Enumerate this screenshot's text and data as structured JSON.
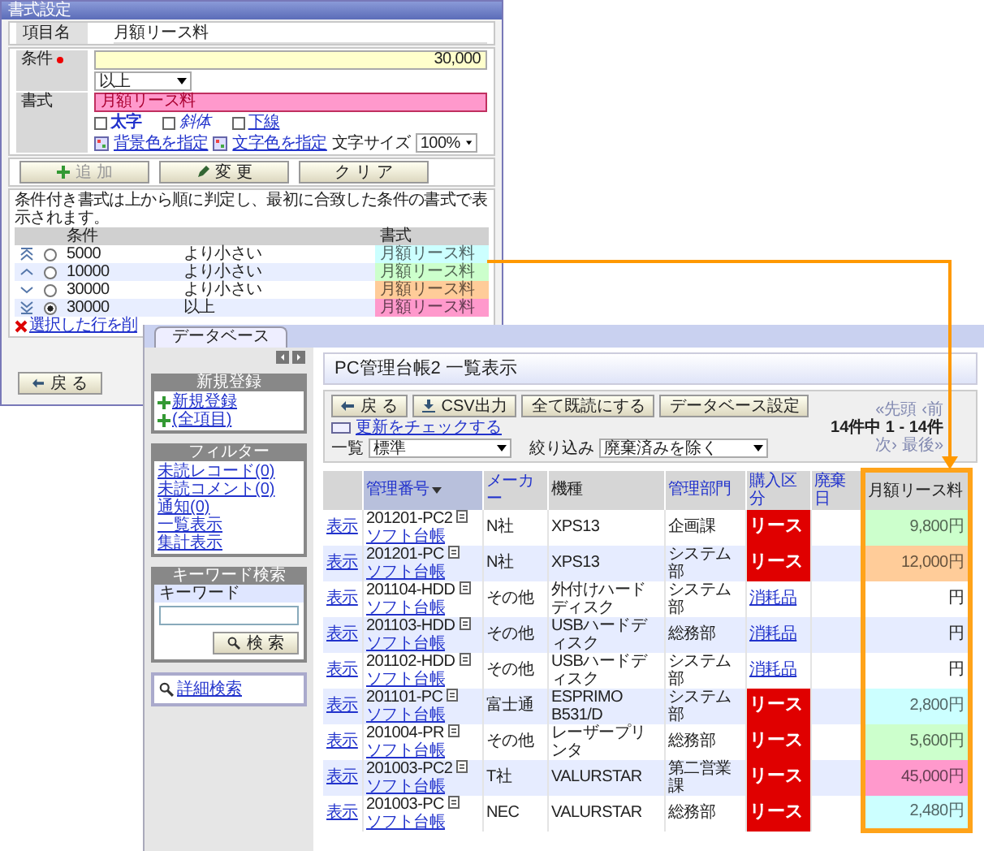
{
  "format_dialog": {
    "title": "書式設定",
    "item_name": {
      "label": "項目名",
      "value": "月額リース料"
    },
    "condition": {
      "label": "条件",
      "required": true,
      "value": "30,000",
      "operator": "以上"
    },
    "format": {
      "label": "書式",
      "preview": "月額リース料",
      "styles": [
        {
          "label": "太字",
          "kind": "bold",
          "checked": false
        },
        {
          "label": "斜体",
          "kind": "italic",
          "checked": false
        },
        {
          "label": "下線",
          "kind": "underline",
          "checked": false
        }
      ],
      "bg_color_link": "背景色を指定",
      "text_color_link": "文字色を指定",
      "size_label": "文字サイズ",
      "size": "100%"
    },
    "buttons": [
      {
        "label": "追 加",
        "disabled": true
      },
      {
        "label": "変 更",
        "disabled": false
      },
      {
        "label": "ク リ ア",
        "disabled": false
      }
    ],
    "note": "条件付き書式は上から順に判定し、最初に合致した条件の書式で表示されます。",
    "rules_table": {
      "columns": [
        "条件",
        "書式"
      ],
      "rows": [
        {
          "value": "5000",
          "operator": "より小さい",
          "preview": "月額リース料",
          "color": "#ccffff",
          "selected": false
        },
        {
          "value": "10000",
          "operator": "より小さい",
          "preview": "月額リース料",
          "color": "#ccffcc",
          "selected": false
        },
        {
          "value": "30000",
          "operator": "より小さい",
          "preview": "月額リース料",
          "color": "#ffcc99",
          "selected": false
        },
        {
          "value": "30000",
          "operator": "以上",
          "preview": "月額リース料",
          "color": "#ff99cc",
          "selected": true
        }
      ]
    },
    "delete_link": "選択した行を削",
    "back_button": "戻 る"
  },
  "database_window": {
    "tab": "データベース",
    "sidebar": {
      "sections": [
        {
          "title": "新規登録",
          "links": [
            "新規登録",
            "(全項目)"
          ]
        },
        {
          "title": "フィルター",
          "links": [
            "未読レコード(0)",
            "未読コメント(0)",
            "通知(0)",
            "一覧表示",
            "集計表示"
          ]
        }
      ],
      "keyword_search": {
        "title": "キーワード検索",
        "label": "キーワード",
        "button": "検 索"
      },
      "advanced_search": "詳細検索"
    },
    "header": "PC管理台帳2 一覧表示",
    "toolbar": {
      "buttons": [
        "戻 る",
        "CSV出力",
        "全て既読にする",
        "データベース設定"
      ],
      "update_link": "更新をチェックする",
      "view": {
        "label": "一覧",
        "value": "標準"
      },
      "filter": {
        "label": "絞り込み",
        "value": "廃棄済みを除く"
      }
    },
    "pager": [
      {
        "label": "«先頭",
        "kind": "link",
        "disabled": true
      },
      {
        "label": "‹前",
        "kind": "link",
        "disabled": true
      },
      {
        "label": "14件中 1 - 14件",
        "kind": "count"
      },
      {
        "label": "次›",
        "kind": "link",
        "disabled": true
      },
      {
        "label": "最後»",
        "kind": "link",
        "disabled": true
      }
    ],
    "table": {
      "columns": [
        {
          "label": "管理番号",
          "link": true,
          "sorted": true
        },
        {
          "label": "メーカー",
          "link": true,
          "sorted": false
        },
        {
          "label": "機種",
          "link": false,
          "sorted": false
        },
        {
          "label": "管理部門",
          "link": true,
          "sorted": false
        },
        {
          "label": "購入区分",
          "link": true,
          "sorted": false
        },
        {
          "label": "廃棄日",
          "link": true,
          "sorted": false
        },
        {
          "label": "月額リース料",
          "link": false,
          "sorted": false
        }
      ],
      "rows": [
        {
          "action": "表示",
          "number": "201201-PC2",
          "doc_link": "ソフト台帳",
          "maker": "N社",
          "model": "XPS13",
          "department": "企画課",
          "purchase": {
            "label": "リース",
            "kind": "lease"
          },
          "fee": {
            "value": "9,800円",
            "color": "#ccffcc"
          }
        },
        {
          "action": "表示",
          "number": "201201-PC",
          "doc_link": "ソフト台帳",
          "maker": "N社",
          "model": "XPS13",
          "department": "システム部",
          "purchase": {
            "label": "リース",
            "kind": "lease"
          },
          "fee": {
            "value": "12,000円",
            "color": "#ffcc99"
          }
        },
        {
          "action": "表示",
          "number": "201104-HDD",
          "doc_link": "ソフト台帳",
          "maker": "その他",
          "model": "外付けハードディスク",
          "department": "システム部",
          "purchase": {
            "label": "消耗品",
            "kind": "consumable"
          },
          "fee": {
            "value": "円"
          }
        },
        {
          "action": "表示",
          "number": "201103-HDD",
          "doc_link": "ソフト台帳",
          "maker": "その他",
          "model": "USBハードディスク",
          "department": "総務部",
          "purchase": {
            "label": "消耗品",
            "kind": "consumable"
          },
          "fee": {
            "value": "円"
          }
        },
        {
          "action": "表示",
          "number": "201102-HDD",
          "doc_link": "ソフト台帳",
          "maker": "その他",
          "model": "USBハードディスク",
          "department": "システム部",
          "purchase": {
            "label": "消耗品",
            "kind": "consumable"
          },
          "fee": {
            "value": "円"
          }
        },
        {
          "action": "表示",
          "number": "201101-PC",
          "doc_link": "ソフト台帳",
          "maker": "富士通",
          "model": "ESPRIMO B531/D",
          "department": "システム部",
          "purchase": {
            "label": "リース",
            "kind": "lease"
          },
          "fee": {
            "value": "2,800円",
            "color": "#ccffff"
          }
        },
        {
          "action": "表示",
          "number": "201004-PR",
          "doc_link": "ソフト台帳",
          "maker": "その他",
          "model": "レーザープリンタ",
          "department": "総務部",
          "purchase": {
            "label": "リース",
            "kind": "lease"
          },
          "fee": {
            "value": "5,600円",
            "color": "#ccffcc"
          }
        },
        {
          "action": "表示",
          "number": "201003-PC2",
          "doc_link": "ソフト台帳",
          "maker": "T社",
          "model": "VALURSTAR",
          "department": "第二営業課",
          "purchase": {
            "label": "リース",
            "kind": "lease"
          },
          "fee": {
            "value": "45,000円",
            "color": "#ff99cc"
          }
        },
        {
          "action": "表示",
          "number": "201003-PC",
          "doc_link": "ソフト台帳",
          "maker": "NEC",
          "model": "VALURSTAR",
          "department": "総務部",
          "purchase": {
            "label": "リース",
            "kind": "lease"
          },
          "fee": {
            "value": "2,480円",
            "color": "#ccffff"
          }
        }
      ]
    }
  }
}
